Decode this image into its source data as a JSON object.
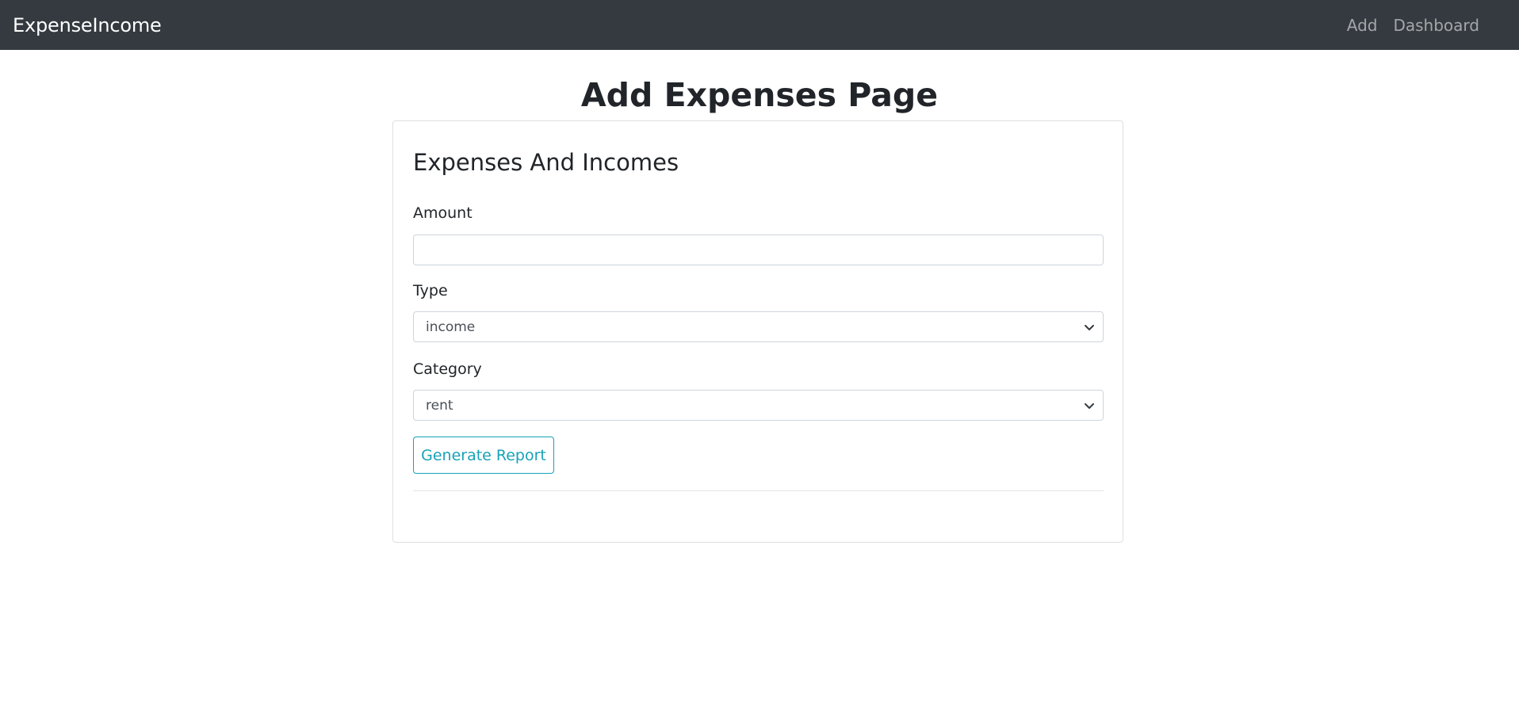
{
  "navbar": {
    "brand": "ExpenseIncome",
    "links": [
      {
        "label": "Add"
      },
      {
        "label": "Dashboard"
      }
    ],
    "bg_color": "#343a40"
  },
  "page": {
    "title": "Add Expenses Page"
  },
  "card": {
    "title": "Expenses And Incomes",
    "fields": {
      "amount": {
        "label": "Amount",
        "value": "",
        "placeholder": ""
      },
      "type": {
        "label": "Type",
        "selected": "income",
        "icon": "chevron-down-icon"
      },
      "category": {
        "label": "Category",
        "selected": "rent",
        "icon": "chevron-down-icon"
      }
    },
    "button": {
      "label": "Generate Report",
      "color": "#17a2b8"
    }
  }
}
